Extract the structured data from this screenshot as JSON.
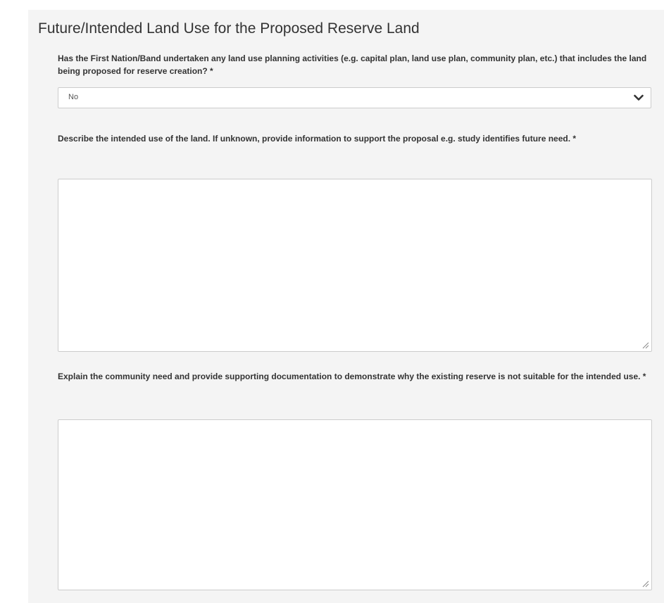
{
  "section": {
    "title": "Future/Intended Land Use for the Proposed Reserve Land"
  },
  "questions": [
    {
      "label": "Has the First Nation/Band undertaken any land use planning activities (e.g. capital plan, land use plan, community plan, etc.) that includes the land being proposed for reserve creation? *",
      "type": "select",
      "value": "No"
    },
    {
      "label": "Describe the intended use of the land. If unknown, provide information to support the proposal e.g. study identifies future need. *",
      "type": "textarea",
      "value": ""
    },
    {
      "label": "Explain the community need and provide supporting documentation to demonstrate why the existing reserve is not suitable for the intended use. *",
      "type": "textarea",
      "value": ""
    }
  ],
  "icons": {
    "dropdown": "chevron-down-icon",
    "resize": "resize-grip-icon"
  },
  "colors": {
    "panel_background": "#f4f4f4",
    "field_border": "#cccccc",
    "text": "#333333"
  }
}
